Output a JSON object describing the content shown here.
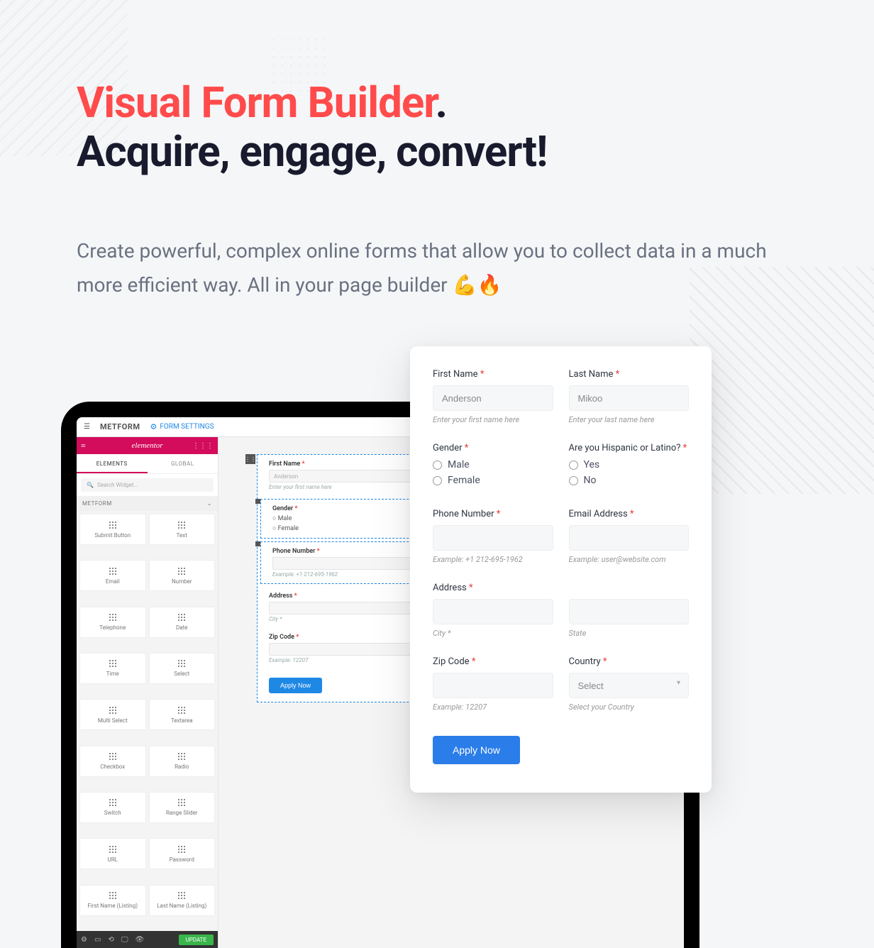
{
  "hero": {
    "title_red": "Visual Form Builder",
    "title_red_suffix": ".",
    "title_dark": "Acquire, engage, convert!",
    "subtitle": "Create powerful, complex online forms that allow you to collect data in a much more efficient way. All in your page builder 💪🔥"
  },
  "editor": {
    "brand": "METFORM",
    "form_settings": "FORM SETTINGS",
    "logo_text": "elementor",
    "tabs": {
      "elements": "ELEMENTS",
      "global": "GLOBAL"
    },
    "search_placeholder": "Search Widget...",
    "category": "METFORM",
    "widgets": [
      "Submit Button",
      "Text",
      "Email",
      "Number",
      "Telephone",
      "Date",
      "Time",
      "Select",
      "Multi Select",
      "Textarea",
      "Checkbox",
      "Radio",
      "Switch",
      "Range Slider",
      "URL",
      "Password",
      "First Name (Listing)",
      "Last Name (Listing)"
    ],
    "update_btn": "UPDATE"
  },
  "canvas": {
    "first_name": {
      "label": "First Name",
      "value": "Anderson",
      "hint": "Enter your first name here"
    },
    "gender": {
      "label": "Gender",
      "options": [
        "Male",
        "Female"
      ]
    },
    "phone": {
      "label": "Phone Number",
      "hint": "Example: +1 212-695-1962"
    },
    "address": {
      "label": "Address",
      "hint": "City *"
    },
    "zip": {
      "label": "Zip Code",
      "hint": "Example: 12207"
    },
    "apply": "Apply Now"
  },
  "preview": {
    "first_name": {
      "label": "First Name",
      "value": "Anderson",
      "hint": "Enter your first name here"
    },
    "last_name": {
      "label": "Last Name",
      "value": "Mikoo",
      "hint": "Enter your last name here"
    },
    "gender": {
      "label": "Gender",
      "options": [
        "Male",
        "Female"
      ]
    },
    "hispanic": {
      "label": "Are you Hispanic or Latino?",
      "options": [
        "Yes",
        "No"
      ]
    },
    "phone": {
      "label": "Phone Number",
      "hint": "Example: +1 212-695-1962"
    },
    "email": {
      "label": "Email Address",
      "hint": "Example: user@website.com"
    },
    "address": {
      "label": "Address",
      "hint_city": "City *",
      "hint_state": "State"
    },
    "zip": {
      "label": "Zip Code",
      "hint": "Example: 12207"
    },
    "country": {
      "label": "Country",
      "select_placeholder": "Select",
      "hint": "Select your Country"
    },
    "apply": "Apply Now"
  }
}
